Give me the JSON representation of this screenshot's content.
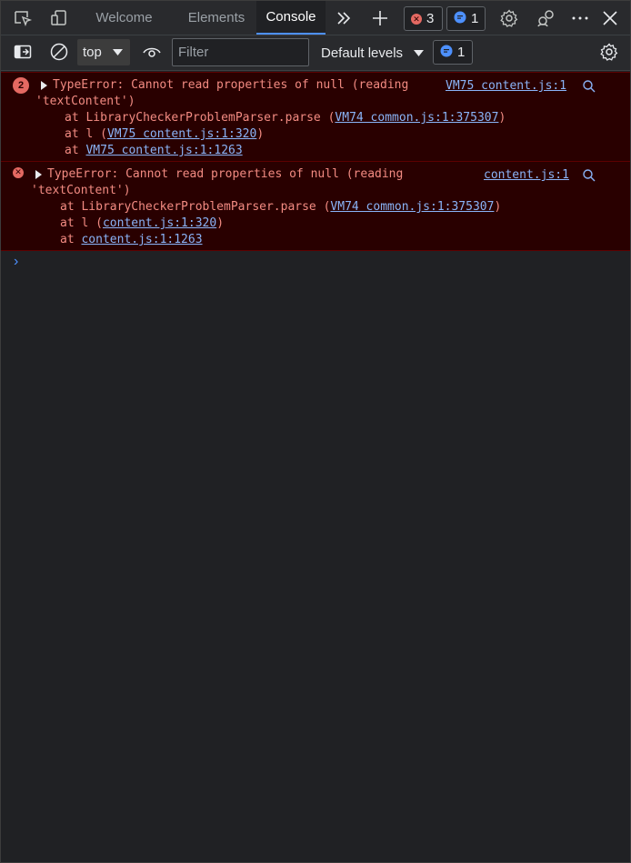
{
  "tabbar": {
    "tabs": [
      {
        "label": "Welcome"
      },
      {
        "label": "Elements"
      },
      {
        "label": "Console"
      }
    ],
    "errors_count": "3",
    "issues_count": "1"
  },
  "toolbar": {
    "context": "top",
    "filter_placeholder": "Filter",
    "levels": "Default levels",
    "issues_count": "1"
  },
  "messages": [
    {
      "repeat_count": "2",
      "text_l1": "TypeError: Cannot read properties of null (reading",
      "text_l2": "'textContent')",
      "source": "VM75 content.js:1",
      "stack": [
        {
          "prefix": "at LibraryCheckerProblemParser.parse (",
          "link": "VM74 common.js:1:375307",
          "suffix": ")"
        },
        {
          "prefix": "at l (",
          "link": "VM75 content.js:1:320",
          "suffix": ")"
        },
        {
          "prefix": "at ",
          "link": "VM75 content.js:1:1263",
          "suffix": ""
        }
      ]
    },
    {
      "text_l1": "TypeError: Cannot read properties of null (reading",
      "text_l2": "'textContent')",
      "source": "content.js:1",
      "stack": [
        {
          "prefix": "at LibraryCheckerProblemParser.parse (",
          "link": "VM74 common.js:1:375307",
          "suffix": ")"
        },
        {
          "prefix": "at l (",
          "link": "content.js:1:320",
          "suffix": ")"
        },
        {
          "prefix": "at ",
          "link": "content.js:1:1263",
          "suffix": ""
        }
      ]
    }
  ],
  "prompt_symbol": "›",
  "colors": {
    "error_bg": "#290000",
    "error_text": "#f28b82",
    "link": "#8ab4f8",
    "accent": "#4d90fe"
  }
}
